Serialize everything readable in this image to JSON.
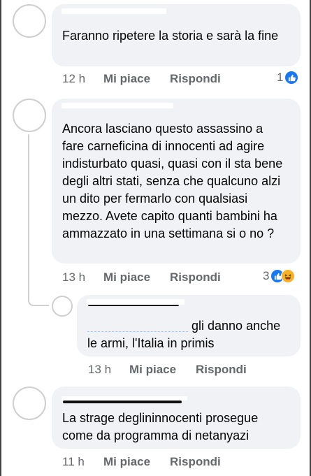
{
  "comments": [
    {
      "text": "Faranno ripetere la storia e sarà la fine",
      "time": "12 h",
      "like_label": "Mi piace",
      "reply_label": "Rispondi",
      "reaction_count": "1"
    },
    {
      "text": "Ancora lasciano questo assassino a fare carneficina di innocenti ad agire indisturbato quasi, quasi con il sta bene degli altri stati, senza che qualcuno alzi un dito per fermarlo con qualsiasi mezzo. Avete capito quanti bambini ha ammazzato in una settimana si o no ?",
      "time": "13 h",
      "like_label": "Mi piace",
      "reply_label": "Rispondi",
      "reaction_count": "3"
    },
    {
      "text_after_mention": " gli danno anche le armi, l'Italia in primis",
      "time": "13 h",
      "like_label": "Mi piace",
      "reply_label": "Rispondi"
    },
    {
      "text": "La strage deglininnocenti prosegue come da programma di netanyazi",
      "time": "11 h",
      "like_label": "Mi piace",
      "reply_label": "Rispondi"
    }
  ],
  "colors": {
    "bubble": "#f0f2f5",
    "meta_text": "#65676b",
    "like_blue": "#1877f2",
    "haha_yellow": "#f7b125"
  },
  "icons": [
    "like-icon",
    "haha-icon"
  ]
}
